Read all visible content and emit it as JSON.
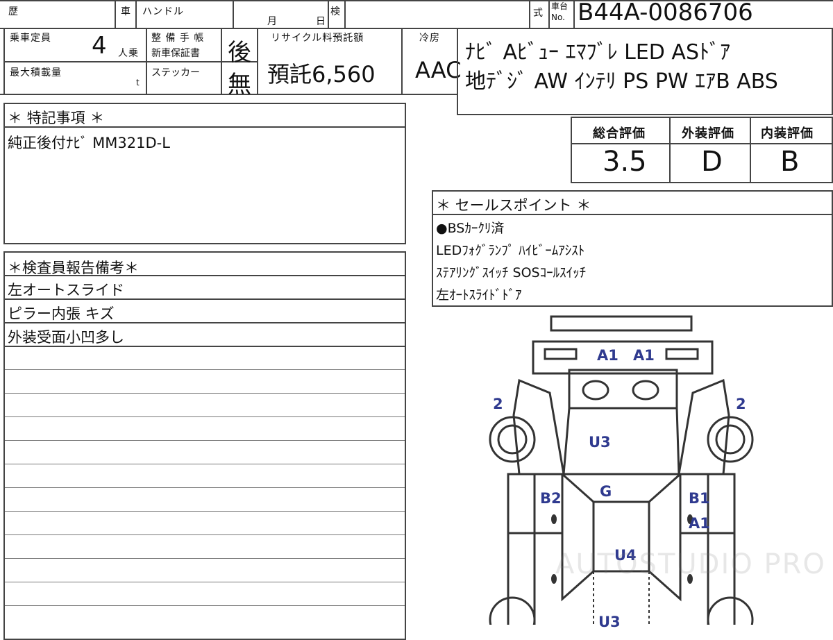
{
  "header": {
    "history_label": "歴",
    "car_label": "車",
    "handle_label": "ハンドル",
    "month_label": "月",
    "day_label": "日",
    "inspection_label": "検",
    "model_label": "式",
    "chassis_label_top": "車台",
    "chassis_label_bottom": "No.",
    "chassis_no": "B44A-0086706"
  },
  "specs": {
    "capacity_label": "乗車定員",
    "capacity_value": "4",
    "capacity_unit": "人乗",
    "max_load_label": "最大積載量",
    "max_load_unit": "t",
    "maintenance_label_1": "整 備 手 帳",
    "maintenance_label_2": "新車保証書",
    "maintenance_value": "後",
    "sticker_label": "ステッカー",
    "sticker_value": "無",
    "recycle_label": "リサイクル料預託額",
    "recycle_value": "預託6,560",
    "aircon_label": "冷房",
    "aircon_value": "AAC"
  },
  "equipment": {
    "line1": "ﾅﾋﾞ Aﾋﾞｭｰ ｴﾏﾌﾞﾚ LED ASﾄﾞｱ",
    "line2": "地ﾃﾞｼﾞ AW ｲﾝﾃﾘ PS PW ｴｱB ABS"
  },
  "ratings": {
    "overall_label": "総合評価",
    "overall_value": "3.5",
    "exterior_label": "外装評価",
    "exterior_value": "D",
    "interior_label": "内装評価",
    "interior_value": "B"
  },
  "notes": {
    "title": "＊ 特記事項 ＊",
    "line1": "純正後付ﾅﾋﾞ MM321D-L"
  },
  "inspector": {
    "title": "＊検査員報告備考＊",
    "lines": [
      "左オートスライド",
      "ピラー内張 キズ",
      "外装受面小凹多し"
    ]
  },
  "sales": {
    "title": "＊ セールスポイント ＊",
    "lines": [
      "●BSｶｰｸﾘ済",
      "LEDﾌｫｸﾞﾗﾝﾌﾟ ﾊｲﾋﾞｰﾑｱｼｽﾄ",
      "ｽﾃｱﾘﾝｸﾞｽｲｯﾁ SOSｺｰﾙｽｲｯﾁ",
      "左ｵｰﾄｽﾗｲﾄﾞﾄﾞｱ"
    ]
  },
  "damage_map": {
    "label_color": "#2f3a8f",
    "labels": {
      "front_left": "A1",
      "front_right": "A1",
      "left_fender": "2",
      "right_fender": "2",
      "hood": "U3",
      "windshield": "G",
      "left_pillar": "B2",
      "right_pillar": "B1",
      "right_door": "A1",
      "roof": "U4",
      "rear": "U3"
    }
  },
  "watermark": "AUTOSTUDIO PRO"
}
